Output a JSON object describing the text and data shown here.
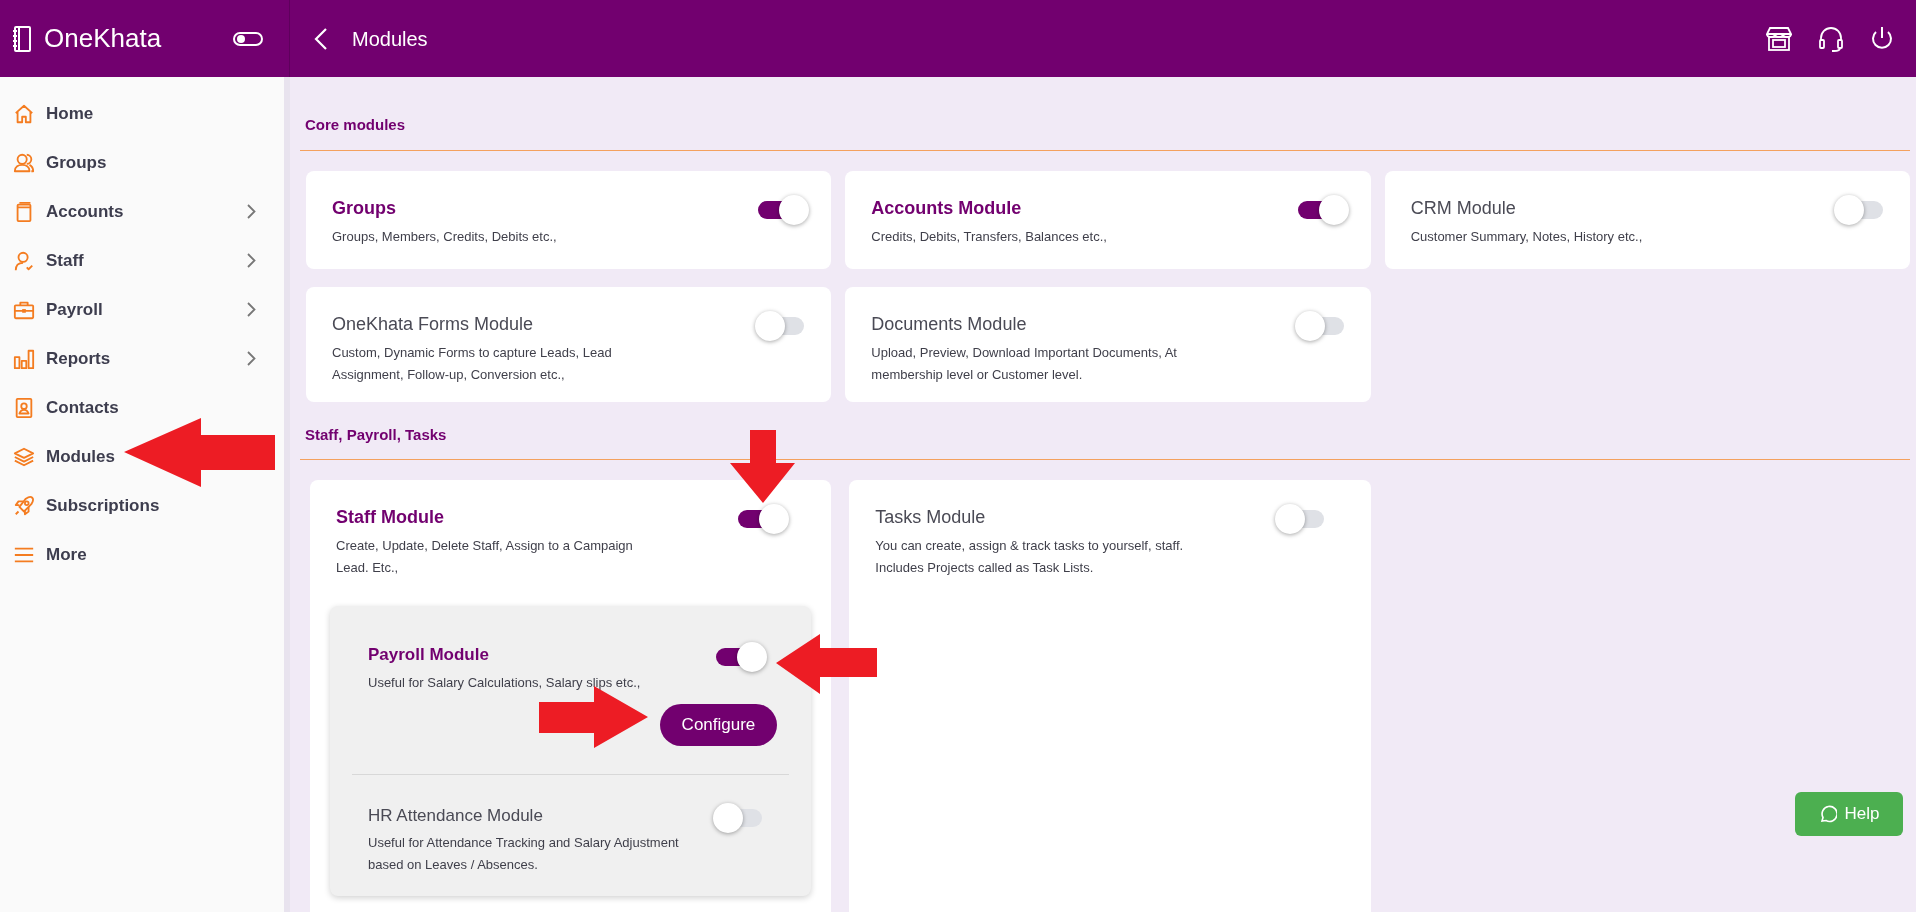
{
  "app": {
    "name": "OneKhata",
    "theme_toggle_on": false
  },
  "header": {
    "title": "Modules"
  },
  "sidebar": {
    "items": [
      {
        "label": "Home"
      },
      {
        "label": "Groups"
      },
      {
        "label": "Accounts",
        "has_submenu": true
      },
      {
        "label": "Staff",
        "has_submenu": true
      },
      {
        "label": "Payroll",
        "has_submenu": true
      },
      {
        "label": "Reports",
        "has_submenu": true
      },
      {
        "label": "Contacts"
      },
      {
        "label": "Modules"
      },
      {
        "label": "Subscriptions"
      },
      {
        "label": "More"
      }
    ]
  },
  "sections": [
    {
      "title": "Core modules",
      "modules": [
        {
          "title": "Groups",
          "description": "Groups, Members, Credits, Debits etc.,",
          "on": true
        },
        {
          "title": "Accounts Module",
          "description": "Credits, Debits, Transfers, Balances etc.,",
          "on": true
        },
        {
          "title": "CRM Module",
          "description": "Customer Summary, Notes, History etc.,",
          "on": false
        },
        {
          "title": "OneKhata Forms Module",
          "description": "Custom, Dynamic Forms to capture Leads, Lead Assignment, Follow-up, Conversion etc.,",
          "on": false
        },
        {
          "title": "Documents Module",
          "description": "Upload, Preview, Download Important Documents, At membership level or Customer level.",
          "on": false
        }
      ]
    },
    {
      "title": "Staff, Payroll, Tasks",
      "modules": [
        {
          "title": "Staff Module",
          "description": "Create, Update, Delete Staff, Assign to a Campaign Lead. Etc.,",
          "on": true,
          "sub_modules": [
            {
              "title": "Payroll Module",
              "description": "Useful for Salary Calculations, Salary slips etc.,",
              "on": true,
              "button": "Configure"
            },
            {
              "title": "HR Attendance Module",
              "description": "Useful for Attendance Tracking and Salary Adjustment based on Leaves / Absences.",
              "on": false
            }
          ]
        },
        {
          "title": "Tasks Module",
          "description": "You can create, assign & track tasks to yourself, staff. Includes Projects called as Task Lists.",
          "on": false
        }
      ]
    }
  ],
  "help_button": "Help"
}
